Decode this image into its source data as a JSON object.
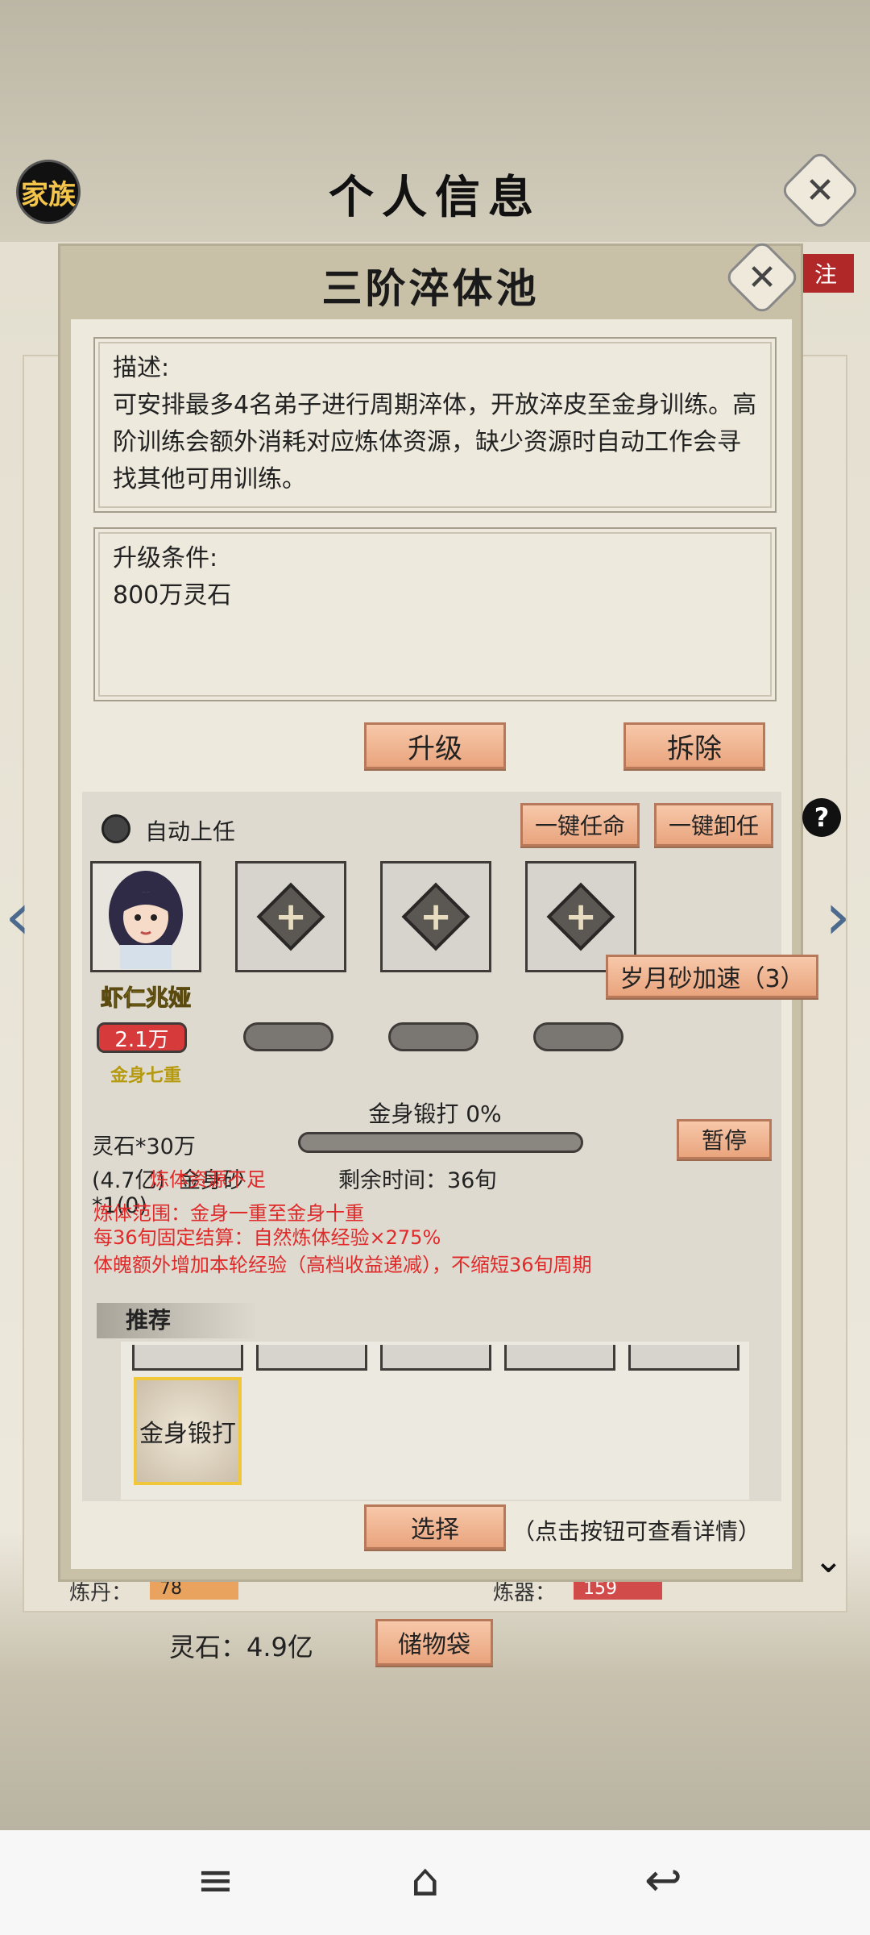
{
  "header": {
    "title": "个人信息",
    "clan_label": "家族"
  },
  "background": {
    "red_tag": "注"
  },
  "modal": {
    "title": "三阶淬体池",
    "description": {
      "heading": "描述:",
      "text": "可安排最多4名弟子进行周期淬体，开放淬皮至金身训练。高阶训练会额外消耗对应炼体资源，缺少资源时自动工作会寻找其他可用训练。"
    },
    "upgrade": {
      "heading": "升级条件:",
      "cost": "800万灵石"
    },
    "upgrade_button": "升级",
    "demolish_button": "拆除",
    "auto_assign_label": "自动上任",
    "assign_all_button": "一键任命",
    "unassign_all_button": "一键卸任",
    "help_icon_glyph": "?",
    "speedup_button": "岁月砂加速（3）",
    "disciple": {
      "name": "虾仁兆娅",
      "power": "2.1万",
      "realm": "金身七重"
    },
    "training": {
      "progress_label": "金身锻打 0%",
      "progress_value": 0,
      "pause_button": "暂停",
      "cost_line1": "灵石*30万",
      "cost_line2": "(4.7亿)  金身砂",
      "cost_line3": "*1(0)",
      "remaining": "剩余时间：36旬",
      "warn_insufficient": "炼体资源不足",
      "range": "炼体范围：金身一重至金身十重",
      "settlement": "每36旬固定结算：自然炼体经验×275%",
      "bonus": "体魄额外增加本轮经验（高档收益递减），不缩短36旬周期"
    },
    "recommend_label": "推荐",
    "recommend_item": "金身锻打",
    "select_button": "选择",
    "select_hint": "（点击按钮可查看详情）"
  },
  "bottom": {
    "spirit_stone": "灵石：4.9亿",
    "storage_button": "储物袋",
    "stat_left": "炼丹：",
    "stat_left_val": "78",
    "stat_right": "炼器：",
    "stat_right_val": "159"
  },
  "navbar": {
    "menu_icon": "≡",
    "home_icon": "⌂",
    "back_icon": "↩"
  }
}
